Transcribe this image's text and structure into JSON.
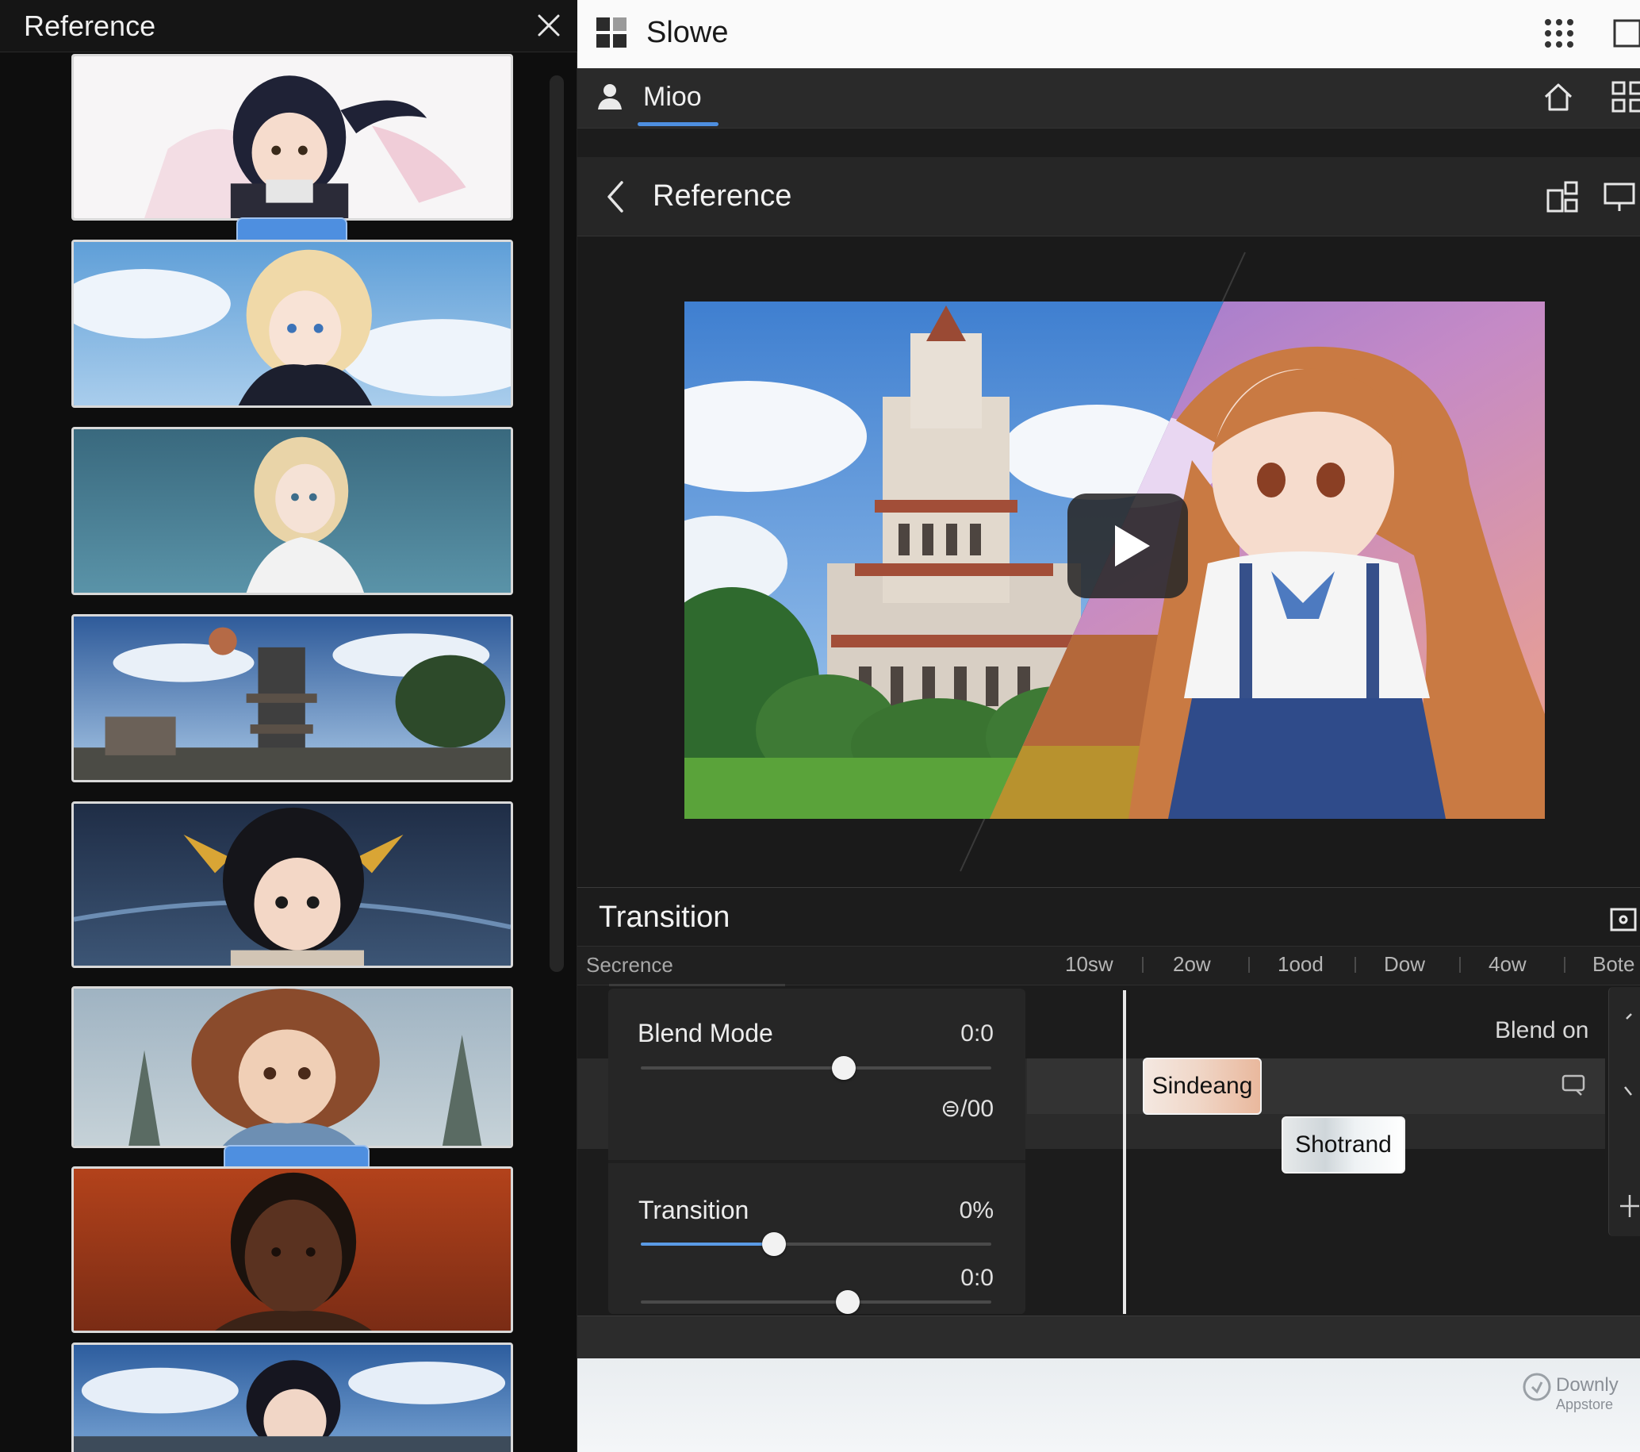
{
  "sidebar": {
    "title": "Reference",
    "thumbnails": [
      {
        "name": "girl-dark-ponytail"
      },
      {
        "name": "girl-blonde-sky"
      },
      {
        "name": "girl-blonde-teal"
      },
      {
        "name": "temple-landscape"
      },
      {
        "name": "boy-dark-spiky"
      },
      {
        "name": "girl-curly"
      },
      {
        "name": "man-red-sky"
      },
      {
        "name": "boy-dark-blue-sky"
      }
    ]
  },
  "app": {
    "title": "Slowe"
  },
  "user_tab": {
    "label": "Mioo"
  },
  "reference_view": {
    "title": "Reference"
  },
  "transition": {
    "title": "Transition",
    "sequence_label": "Secrence",
    "ruler_ticks": [
      "10sw",
      "2ow",
      "1ood",
      "Dow",
      "4ow",
      "Bote"
    ],
    "blend_label": "Blend on",
    "clips": [
      "Sindeang",
      "Shotrand"
    ],
    "sliders": {
      "blend_mode": {
        "label": "Blend Mode",
        "value": "0:0",
        "level": 0.58
      },
      "blend_sub_value": "⊜/00",
      "transition": {
        "label": "Transition",
        "value": "0%",
        "level": 0.38
      },
      "extra": {
        "value": "0:0",
        "level": 0.59
      }
    }
  },
  "watermark": {
    "name": "Downly",
    "sub": "Appstore"
  },
  "colors": {
    "accent": "#4e8fe0",
    "panel_dark": "#1c1c1c",
    "app_bar": "#fafafa"
  },
  "icons": {
    "close": "close-icon",
    "logo": "app-logo-icon",
    "apps": "apps-grid-icon",
    "window": "window-icon",
    "user": "user-icon",
    "home": "home-icon",
    "grid": "grid-view-icon",
    "back": "chevron-left-icon",
    "share": "share-icon",
    "present": "present-icon",
    "play": "play-icon",
    "expand": "expand-icon"
  }
}
